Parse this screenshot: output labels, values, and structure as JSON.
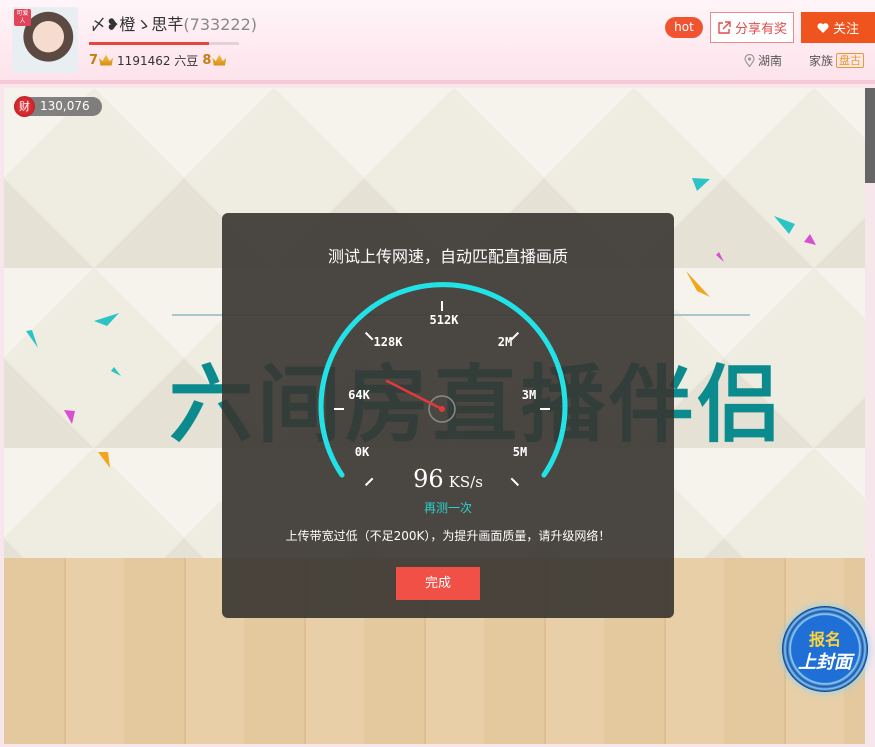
{
  "header": {
    "anchor_name": "〆❥橙ゝ思芊",
    "room_id": "(733222)",
    "avatar_badge": "可爱人",
    "level_progress": 0.8,
    "anchor_level": "7",
    "beans": "1191462 六豆",
    "rich_level": "8",
    "hot_label": "hot",
    "share_label": "分享有奖",
    "follow_label": "关注",
    "location": "湖南",
    "family_label": "家族",
    "family_tag": "盘古"
  },
  "stage": {
    "wealth_icon": "财",
    "wealth_value": "130,076",
    "background_brand": "六间房直播伴侣",
    "cover_badge": {
      "line1": "报名",
      "line2": "上封面"
    }
  },
  "speed_test": {
    "title": "测试上传网速，自动匹配直播画质",
    "dial_labels": [
      "0K",
      "64K",
      "128K",
      "512K",
      "2M",
      "3M",
      "5M"
    ],
    "speed_value": "96",
    "speed_unit": "KS/s",
    "retest_label": "再测一次",
    "notice": "上传带宽过低（不足200K），为提升画面质量，请升级网络！",
    "done_label": "完成"
  },
  "colors": {
    "accent_red": "#f05046",
    "follow_orange": "#f0541e",
    "gauge_cyan": "#2bd1d1",
    "brand_teal": "#0b8b8d"
  },
  "icons": [
    "share-icon",
    "heart-icon",
    "location-pin-icon",
    "crown-icon",
    "wealth-icon"
  ]
}
